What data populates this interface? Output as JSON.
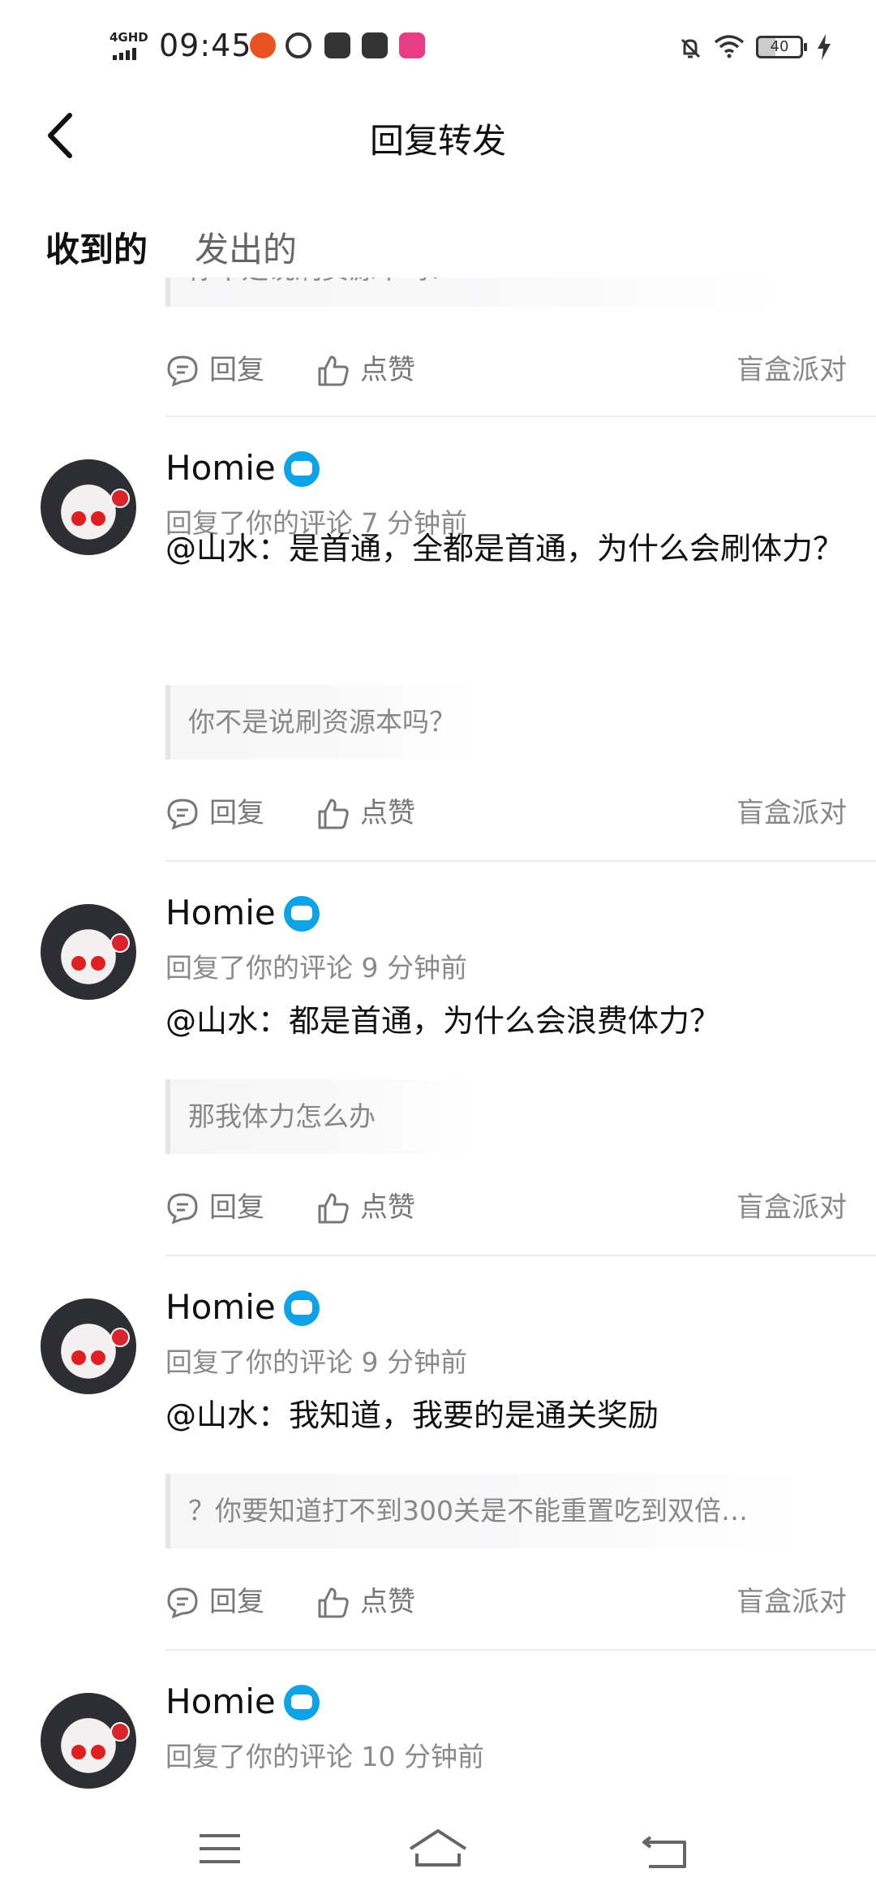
{
  "status_bar": {
    "network": "4GHD",
    "time": "09:45",
    "battery": "40",
    "app_icon_colors": [
      "#e8531f",
      "#333333",
      "#333333",
      "#333333",
      "#e83c86"
    ]
  },
  "header": {
    "title": "回复转发",
    "back_icon": "chevron-left-icon"
  },
  "tabs": [
    {
      "label": "收到的",
      "active": true
    },
    {
      "label": "发出的",
      "active": false
    }
  ],
  "accent_color": "#1ccfc0",
  "partial_item": {
    "quote_fragment": "你不是说刷资源本吗？",
    "reply_label": "回复",
    "like_label": "点赞",
    "source": "盲盒派对"
  },
  "items": [
    {
      "username": "Homie",
      "meta": "回复了你的评论  7  分钟前",
      "content": "@山水：是首通，全都是首通，为什么会刷体力？",
      "quote": "你不是说刷资源本吗？",
      "reply_label": "回复",
      "like_label": "点赞",
      "source": "盲盒派对"
    },
    {
      "username": "Homie",
      "meta": "回复了你的评论  9  分钟前",
      "content": "@山水：都是首通，为什么会浪费体力？",
      "quote": "那我体力怎么办",
      "reply_label": "回复",
      "like_label": "点赞",
      "source": "盲盒派对"
    },
    {
      "username": "Homie",
      "meta": "回复了你的评论  9  分钟前",
      "content": "@山水：我知道，我要的是通关奖励",
      "quote": "？你要知道打不到300关是不能重置吃到双倍…",
      "reply_label": "回复",
      "like_label": "点赞",
      "source": "盲盒派对"
    },
    {
      "username": "Homie",
      "meta": "回复了你的评论  10  分钟前"
    }
  ],
  "nav": {
    "menu_icon": "menu-icon",
    "home_icon": "home-icon",
    "back_icon": "return-icon"
  }
}
